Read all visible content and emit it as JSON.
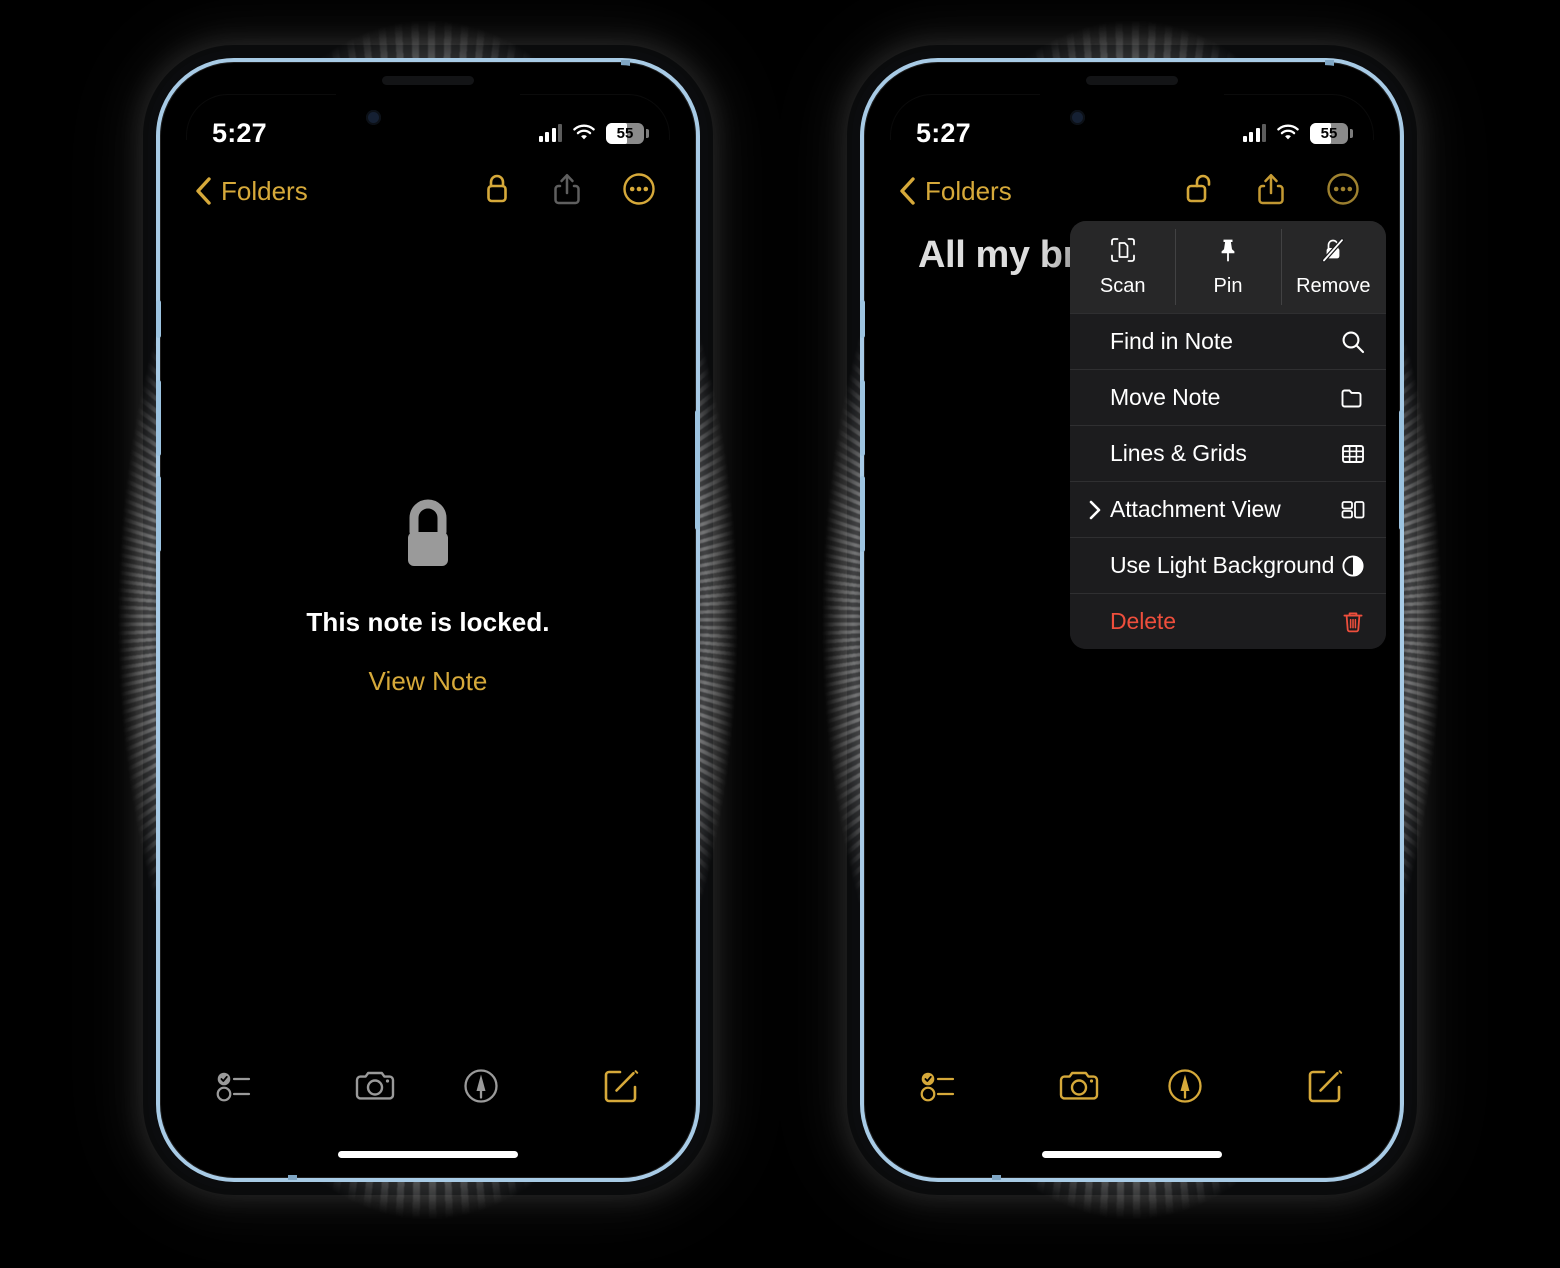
{
  "screens": [
    {
      "id": "locked-note-screen",
      "status_bar": {
        "time": "5:27",
        "battery_level": "55",
        "signal_bars": 3,
        "wifi": "wifi-icon"
      },
      "nav": {
        "back_label": "Folders",
        "back_icon": "chevron-left-icon",
        "lock_icon": "lock-closed-icon",
        "lock_state": "locked",
        "share_icon": "share-icon",
        "share_enabled": false,
        "more_icon": "ellipsis-circle-icon"
      },
      "body": {
        "lock_glyph": "lock-closed-filled-icon",
        "locked_message": "This note is locked.",
        "view_note_label": "View Note"
      },
      "toolbar": {
        "checklist_icon": "checklist-icon",
        "camera_icon": "camera-icon",
        "markup_icon": "markup-pen-icon",
        "compose_icon": "compose-icon",
        "tint": "#9a9a9a",
        "compose_tint": "#d6a93a"
      }
    },
    {
      "id": "note-menu-screen",
      "status_bar": {
        "time": "5:27",
        "battery_level": "55",
        "signal_bars": 3,
        "wifi": "wifi-icon"
      },
      "nav": {
        "back_label": "Folders",
        "back_icon": "chevron-left-icon",
        "lock_icon": "lock-open-icon",
        "lock_state": "unlocked",
        "share_icon": "share-icon",
        "share_enabled": true,
        "more_icon": "ellipsis-circle-icon"
      },
      "body": {
        "note_title": "All my br"
      },
      "menu": {
        "actions": [
          {
            "label": "Scan",
            "icon": "scan-document-icon"
          },
          {
            "label": "Pin",
            "icon": "pin-icon"
          },
          {
            "label": "Remove",
            "icon": "lock-slash-icon"
          }
        ],
        "rows": [
          {
            "label": "Find in Note",
            "icon": "search-icon",
            "submenu": false,
            "destructive": false
          },
          {
            "label": "Move Note",
            "icon": "folder-icon",
            "submenu": false,
            "destructive": false
          },
          {
            "label": "Lines & Grids",
            "icon": "grid-icon",
            "submenu": false,
            "destructive": false
          },
          {
            "label": "Attachment View",
            "icon": "attachment-view-icon",
            "submenu": true,
            "destructive": false
          },
          {
            "label": "Use Light Background",
            "icon": "contrast-circle-icon",
            "submenu": false,
            "destructive": false
          },
          {
            "label": "Delete",
            "icon": "trash-icon",
            "submenu": false,
            "destructive": true
          }
        ]
      },
      "toolbar": {
        "checklist_icon": "checklist-icon",
        "camera_icon": "camera-icon",
        "markup_icon": "markup-pen-icon",
        "compose_icon": "compose-icon",
        "tint": "#d6a93a",
        "compose_tint": "#d6a93a"
      }
    }
  ],
  "colors": {
    "accent_yellow": "#d6a93a",
    "destructive_red": "#ee4e3c",
    "menu_bg": "#1c1c1e",
    "menu_action_bg": "#272728",
    "frame_blue": "#a8cbe6",
    "screen_bg": "#000000"
  }
}
